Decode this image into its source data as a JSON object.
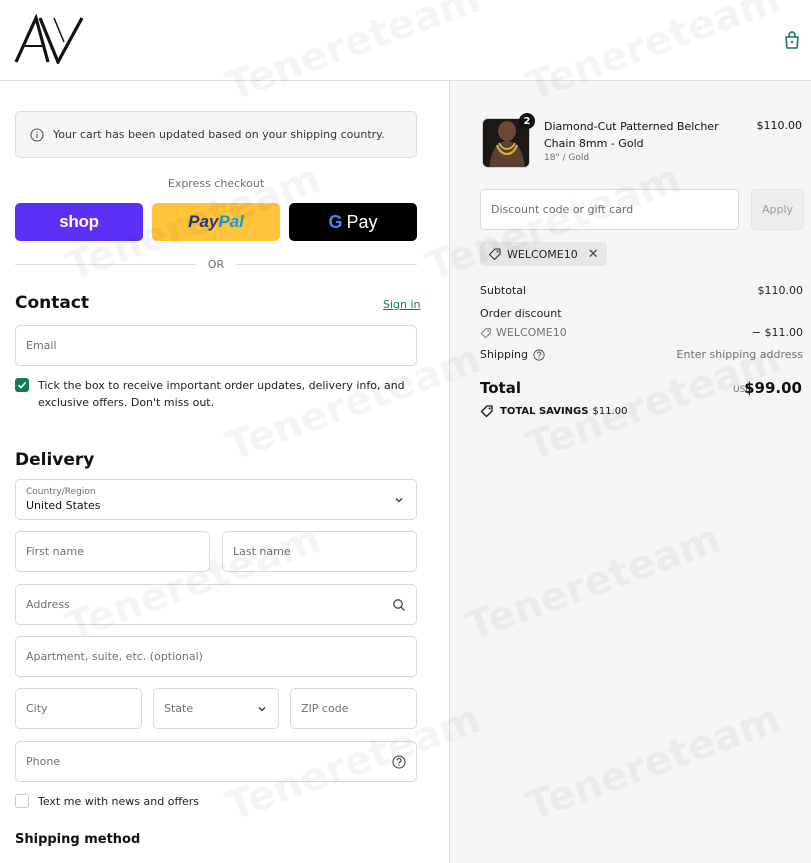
{
  "header": {
    "logo_text": "AV",
    "cart_icon": "shopping-bag-icon"
  },
  "notice": {
    "text": "Your cart has been updated based on your shipping country.",
    "icon": "info-icon"
  },
  "express": {
    "label": "Express checkout",
    "shop_label": "shop",
    "paypal_label_a": "Pay",
    "paypal_label_b": "Pal",
    "gpay_g": "G",
    "gpay_label": "Pay",
    "or_label": "OR"
  },
  "contact": {
    "title": "Contact",
    "signin": "Sign in",
    "email_placeholder": "Email",
    "optin_text": "Tick the box to receive important order updates, delivery info, and exclusive offers. Don't miss out.",
    "optin_checked": true
  },
  "delivery": {
    "title": "Delivery",
    "country_label": "Country/Region",
    "country_value": "United States",
    "first_name": "First name",
    "last_name": "Last name",
    "address": "Address",
    "apartment": "Apartment, suite, etc. (optional)",
    "city": "City",
    "state": "State",
    "zip": "ZIP code",
    "phone": "Phone",
    "sms_text": "Text me with news and offers",
    "sms_checked": false
  },
  "shipping_method": {
    "title": "Shipping method"
  },
  "summary": {
    "product": {
      "name": "Diamond-Cut Patterned Belcher Chain 8mm - Gold",
      "variant": "18\" / Gold",
      "price": "$110.00",
      "quantity": "2"
    },
    "discount_placeholder": "Discount code or gift card",
    "apply_label": "Apply",
    "applied_code": "WELCOME10",
    "subtotal_label": "Subtotal",
    "subtotal_value": "$110.00",
    "order_discount_label": "Order discount",
    "discount_code": "WELCOME10",
    "discount_value": "− $11.00",
    "shipping_label": "Shipping",
    "shipping_value": "Enter shipping address",
    "total_label": "Total",
    "currency": "USD",
    "total_value": "$99.00",
    "savings_label": "TOTAL SAVINGS",
    "savings_value": "$11.00"
  },
  "watermark": "Tenereteam",
  "colors": {
    "accent_green": "#197b52",
    "shop_purple": "#5a31f4",
    "paypal_yellow": "#ffc439",
    "gpay_black": "#000000"
  }
}
